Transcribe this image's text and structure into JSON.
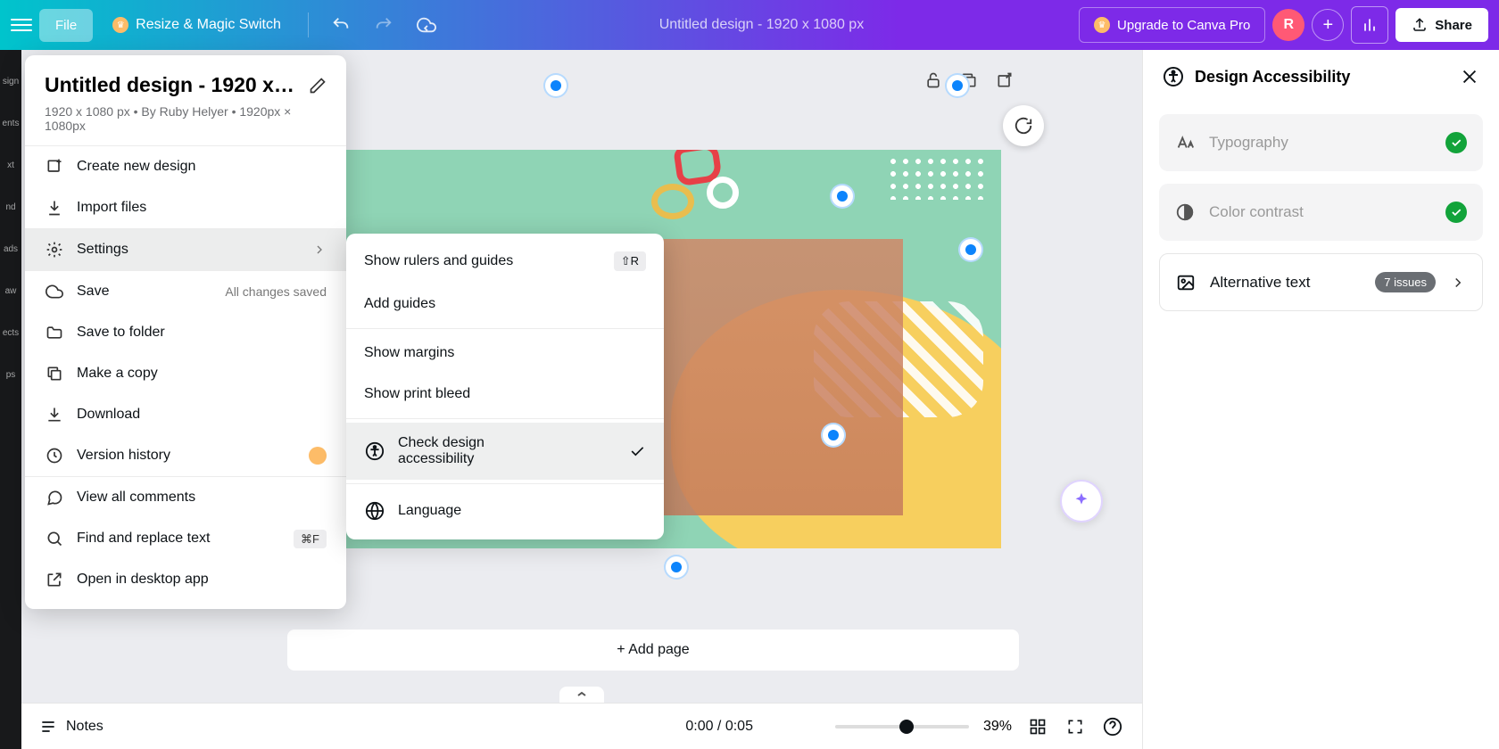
{
  "topbar": {
    "file_label": "File",
    "resize_label": "Resize & Magic Switch",
    "doc_title": "Untitled design - 1920 x 1080 px",
    "upgrade_label": "Upgrade to Canva Pro",
    "avatar_initial": "R",
    "share_label": "Share"
  },
  "sidebar": {
    "items": [
      "sign",
      "ents",
      "xt",
      "nd",
      "ads",
      "aw",
      "ects",
      "ps"
    ]
  },
  "file_menu": {
    "title": "Untitled design - 1920 x 108...",
    "meta": "1920 x 1080 px • By Ruby Helyer • 1920px × 1080px",
    "create_new": "Create new design",
    "import_files": "Import files",
    "settings": "Settings",
    "save": "Save",
    "save_status": "All changes saved",
    "save_to_folder": "Save to folder",
    "make_copy": "Make a copy",
    "download": "Download",
    "version_history": "Version history",
    "view_comments": "View all comments",
    "find_replace": "Find and replace text",
    "find_kbd": "⌘F",
    "open_desktop": "Open in desktop app"
  },
  "settings_menu": {
    "rulers": "Show rulers and guides",
    "rulers_kbd": "⇧R",
    "add_guides": "Add guides",
    "margins": "Show margins",
    "print_bleed": "Show print bleed",
    "accessibility_l1": "Check design",
    "accessibility_l2": "accessibility",
    "language": "Language"
  },
  "canvas": {
    "add_page": "+ Add page"
  },
  "bottom_bar": {
    "notes": "Notes",
    "timecode": "0:00 / 0:05",
    "zoom": "39%"
  },
  "right_panel": {
    "title": "Design Accessibility",
    "typography": "Typography",
    "color_contrast": "Color contrast",
    "alt_text": "Alternative text",
    "alt_badge": "7 issues"
  }
}
